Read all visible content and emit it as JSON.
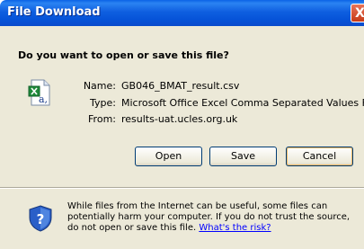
{
  "window": {
    "title": "File Download",
    "close_glyph": "X"
  },
  "dialog": {
    "question": "Do you want to open or save this file?",
    "file_icon": "excel-csv-file-icon",
    "fields": [
      {
        "label": "Name:",
        "value": "GB046_BMAT_result.csv"
      },
      {
        "label": "Type:",
        "value": "Microsoft Office Excel Comma Separated Values Fil..."
      },
      {
        "label": "From:",
        "value": "results-uat.ucles.org.uk"
      }
    ],
    "buttons": {
      "open": "Open",
      "save": "Save",
      "cancel": "Cancel"
    },
    "warning_icon": "shield-question-icon",
    "warning_text": "While files from the Internet can be useful, some files can potentially harm your computer. If you do not trust the source, do not open or save this file.",
    "risk_link": "What's the risk?"
  },
  "colors": {
    "titlebar": "#0a62e6",
    "dialog_bg": "#ece9d8",
    "link": "#0000ff",
    "close": "#c63a17"
  }
}
